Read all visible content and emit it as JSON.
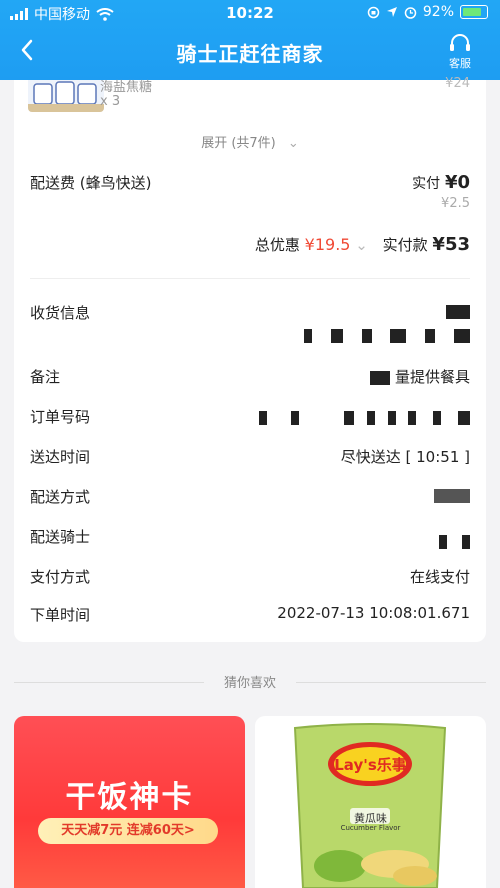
{
  "status_bar": {
    "carrier": "中国移动",
    "time": "10:22",
    "battery": "92%"
  },
  "nav": {
    "title": "骑士正赶往商家",
    "service_label": "客服"
  },
  "item": {
    "name": "海盐焦糖",
    "qty": "x 3",
    "price": "¥24"
  },
  "expand_label": "展开 (共7件)",
  "delivery_fee": {
    "label": "配送费 (蜂鸟快送)",
    "paid_label": "实付",
    "paid_value": "¥0",
    "original": "¥2.5"
  },
  "totals": {
    "discount_label": "总优惠",
    "discount_value": "¥19.5",
    "paid_label": "实付款",
    "paid_value": "¥53"
  },
  "details": {
    "receiver_label": "收货信息",
    "note_label": "备注",
    "note_value": "量提供餐具",
    "order_no_label": "订单号码",
    "delivery_time_label": "送达时间",
    "delivery_time_value": "尽快送达 [ 10:51 ]",
    "delivery_method_label": "配送方式",
    "rider_label": "配送骑士",
    "payment_label": "支付方式",
    "payment_value": "在线支付",
    "order_time_label": "下单时间",
    "order_time_value": "2022-07-13 10:08:01.671"
  },
  "guess_label": "猜你喜欢",
  "promo": {
    "title": "干饭神卡",
    "pill": "天天减7元 连减60天>"
  },
  "product": {
    "brand": "Lay's乐事",
    "flavor": "黄瓜味",
    "flavor_en": "Cucumber Flavor"
  },
  "colors": {
    "header": "#1e9df2",
    "accent_red": "#f04a36",
    "promo_red": "#ff3a3a"
  }
}
